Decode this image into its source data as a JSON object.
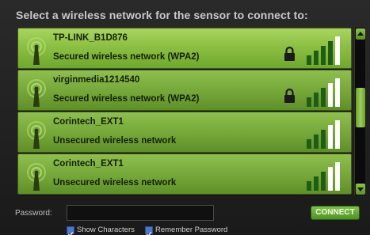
{
  "header": {
    "title": "Select a wireless network for the sensor to connect to:"
  },
  "networks": [
    {
      "ssid": "TP-LINK_B1D876",
      "security": "Secured wireless network (WPA2)",
      "locked": true,
      "signal_bars": 4,
      "selected": true
    },
    {
      "ssid": "virginmedia1214540",
      "security": "Secured wireless network (WPA2)",
      "locked": true,
      "signal_bars": 3,
      "selected": false
    },
    {
      "ssid": "Corintech_EXT1",
      "security": "Unsecured wireless network",
      "locked": false,
      "signal_bars": 3,
      "selected": false
    },
    {
      "ssid": "Corintech_EXT1",
      "security": "Unsecured wireless network",
      "locked": false,
      "signal_bars": 3,
      "selected": false
    }
  ],
  "password": {
    "label": "Password:",
    "value": ""
  },
  "options": {
    "show_characters": "Show Characters",
    "remember_password": "Remember Password"
  },
  "connect_label": "CONNECT",
  "colors": {
    "accent_green": "#8cc043",
    "bar_dark": "#1f5e12",
    "bar_light": "#ffffff",
    "checkbox_blue": "#4a79c8"
  }
}
